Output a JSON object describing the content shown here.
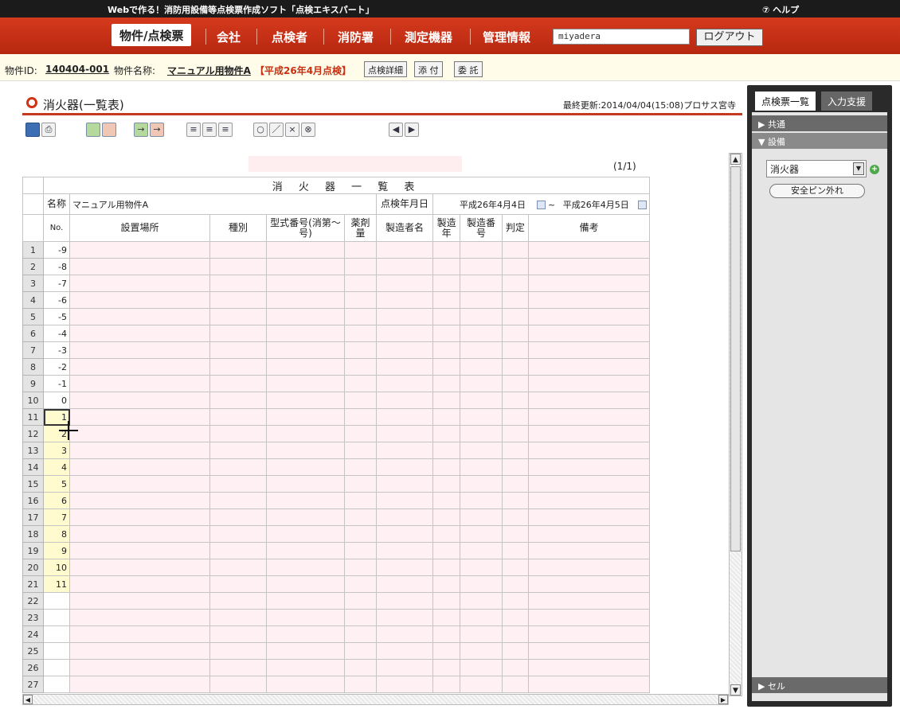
{
  "app": {
    "title": "Webで作る！消防用設備等点検票作成ソフト「点検エキスパート」",
    "help": "⑦ ヘルプ"
  },
  "nav": {
    "items": [
      "物件/点検票",
      "会社",
      "点検者",
      "消防署",
      "測定機器",
      "管理情報"
    ],
    "user_value": "miyadera",
    "logout_label": "ログアウト"
  },
  "info": {
    "id_label": "物件ID:",
    "id_value": "140404-001",
    "name_label": "物件名称:",
    "name_value": "マニュアル用物件A",
    "period": "【平成26年4月点検】",
    "buttons": [
      "点検詳細",
      "添 付",
      "委 託"
    ]
  },
  "panel": {
    "title": "消火器(一覧表)",
    "updated": "最終更新:2014/04/04(15:08)プロサス宮寺"
  },
  "toolbar": {
    "icons": [
      "save-icon",
      "print-icon",
      "insert-row-icon",
      "delete-row-icon",
      "insert-col-icon",
      "delete-col-icon",
      "align-left-icon",
      "align-center-icon",
      "align-right-icon",
      "circle-mark-icon",
      "slash-mark-icon",
      "cross-mark-icon",
      "circled-x-icon",
      "prev-arrow-icon",
      "next-arrow-icon"
    ]
  },
  "sheet": {
    "page_count": "(1/1)",
    "table_title": "消 火 器 一 覧 表",
    "name_label": "名称",
    "name_value": "マニュアル用物件A",
    "date_label": "点検年月日",
    "date_from": "平成26年4月4日",
    "tilde": "~",
    "date_to": "平成26年4月5日",
    "headers": [
      "No.",
      "設置場所",
      "種別",
      "型式番号(消第～号)",
      "薬剤量",
      "製造者名",
      "製造年",
      "製造番号",
      "判定",
      "備考"
    ],
    "row_numbers": [
      "1",
      "2",
      "3",
      "4",
      "5",
      "6",
      "7",
      "8",
      "9",
      "10",
      "11",
      "12",
      "13",
      "14",
      "15",
      "16",
      "17",
      "18",
      "19",
      "20",
      "21",
      "22",
      "23",
      "24",
      "25",
      "26",
      "27"
    ],
    "no_values": [
      "-9",
      "-8",
      "-7",
      "-6",
      "-5",
      "-4",
      "-3",
      "-2",
      "-1",
      "0",
      "1",
      "2",
      "3",
      "4",
      "5",
      "6",
      "7",
      "8",
      "9",
      "10",
      "11",
      "",
      "",
      "",
      "",
      "",
      ""
    ]
  },
  "right": {
    "tab_active": "点検票一覧",
    "tab_inactive": "入力支援",
    "acc_common": "▶ 共通",
    "acc_equipment": "▼ 設備",
    "equipment_value": "消火器",
    "pill_label": "安全ピン外れ",
    "acc_cell": "▶ セル"
  },
  "colors": {
    "nav_red": "#c8321a",
    "accent": "#c53a1e",
    "cell_pink": "#fff0f3",
    "highlight_yellow": "#fffbcf"
  }
}
